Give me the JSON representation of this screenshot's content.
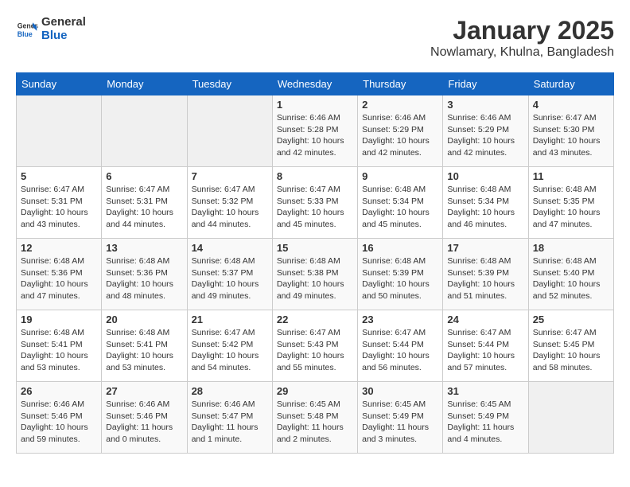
{
  "header": {
    "logo_general": "General",
    "logo_blue": "Blue",
    "title": "January 2025",
    "subtitle": "Nowlamary, Khulna, Bangladesh"
  },
  "days_of_week": [
    "Sunday",
    "Monday",
    "Tuesday",
    "Wednesday",
    "Thursday",
    "Friday",
    "Saturday"
  ],
  "weeks": [
    [
      {
        "day": "",
        "info": ""
      },
      {
        "day": "",
        "info": ""
      },
      {
        "day": "",
        "info": ""
      },
      {
        "day": "1",
        "info": "Sunrise: 6:46 AM\nSunset: 5:28 PM\nDaylight: 10 hours\nand 42 minutes."
      },
      {
        "day": "2",
        "info": "Sunrise: 6:46 AM\nSunset: 5:29 PM\nDaylight: 10 hours\nand 42 minutes."
      },
      {
        "day": "3",
        "info": "Sunrise: 6:46 AM\nSunset: 5:29 PM\nDaylight: 10 hours\nand 42 minutes."
      },
      {
        "day": "4",
        "info": "Sunrise: 6:47 AM\nSunset: 5:30 PM\nDaylight: 10 hours\nand 43 minutes."
      }
    ],
    [
      {
        "day": "5",
        "info": "Sunrise: 6:47 AM\nSunset: 5:31 PM\nDaylight: 10 hours\nand 43 minutes."
      },
      {
        "day": "6",
        "info": "Sunrise: 6:47 AM\nSunset: 5:31 PM\nDaylight: 10 hours\nand 44 minutes."
      },
      {
        "day": "7",
        "info": "Sunrise: 6:47 AM\nSunset: 5:32 PM\nDaylight: 10 hours\nand 44 minutes."
      },
      {
        "day": "8",
        "info": "Sunrise: 6:47 AM\nSunset: 5:33 PM\nDaylight: 10 hours\nand 45 minutes."
      },
      {
        "day": "9",
        "info": "Sunrise: 6:48 AM\nSunset: 5:34 PM\nDaylight: 10 hours\nand 45 minutes."
      },
      {
        "day": "10",
        "info": "Sunrise: 6:48 AM\nSunset: 5:34 PM\nDaylight: 10 hours\nand 46 minutes."
      },
      {
        "day": "11",
        "info": "Sunrise: 6:48 AM\nSunset: 5:35 PM\nDaylight: 10 hours\nand 47 minutes."
      }
    ],
    [
      {
        "day": "12",
        "info": "Sunrise: 6:48 AM\nSunset: 5:36 PM\nDaylight: 10 hours\nand 47 minutes."
      },
      {
        "day": "13",
        "info": "Sunrise: 6:48 AM\nSunset: 5:36 PM\nDaylight: 10 hours\nand 48 minutes."
      },
      {
        "day": "14",
        "info": "Sunrise: 6:48 AM\nSunset: 5:37 PM\nDaylight: 10 hours\nand 49 minutes."
      },
      {
        "day": "15",
        "info": "Sunrise: 6:48 AM\nSunset: 5:38 PM\nDaylight: 10 hours\nand 49 minutes."
      },
      {
        "day": "16",
        "info": "Sunrise: 6:48 AM\nSunset: 5:39 PM\nDaylight: 10 hours\nand 50 minutes."
      },
      {
        "day": "17",
        "info": "Sunrise: 6:48 AM\nSunset: 5:39 PM\nDaylight: 10 hours\nand 51 minutes."
      },
      {
        "day": "18",
        "info": "Sunrise: 6:48 AM\nSunset: 5:40 PM\nDaylight: 10 hours\nand 52 minutes."
      }
    ],
    [
      {
        "day": "19",
        "info": "Sunrise: 6:48 AM\nSunset: 5:41 PM\nDaylight: 10 hours\nand 53 minutes."
      },
      {
        "day": "20",
        "info": "Sunrise: 6:48 AM\nSunset: 5:41 PM\nDaylight: 10 hours\nand 53 minutes."
      },
      {
        "day": "21",
        "info": "Sunrise: 6:47 AM\nSunset: 5:42 PM\nDaylight: 10 hours\nand 54 minutes."
      },
      {
        "day": "22",
        "info": "Sunrise: 6:47 AM\nSunset: 5:43 PM\nDaylight: 10 hours\nand 55 minutes."
      },
      {
        "day": "23",
        "info": "Sunrise: 6:47 AM\nSunset: 5:44 PM\nDaylight: 10 hours\nand 56 minutes."
      },
      {
        "day": "24",
        "info": "Sunrise: 6:47 AM\nSunset: 5:44 PM\nDaylight: 10 hours\nand 57 minutes."
      },
      {
        "day": "25",
        "info": "Sunrise: 6:47 AM\nSunset: 5:45 PM\nDaylight: 10 hours\nand 58 minutes."
      }
    ],
    [
      {
        "day": "26",
        "info": "Sunrise: 6:46 AM\nSunset: 5:46 PM\nDaylight: 10 hours\nand 59 minutes."
      },
      {
        "day": "27",
        "info": "Sunrise: 6:46 AM\nSunset: 5:46 PM\nDaylight: 11 hours\nand 0 minutes."
      },
      {
        "day": "28",
        "info": "Sunrise: 6:46 AM\nSunset: 5:47 PM\nDaylight: 11 hours\nand 1 minute."
      },
      {
        "day": "29",
        "info": "Sunrise: 6:45 AM\nSunset: 5:48 PM\nDaylight: 11 hours\nand 2 minutes."
      },
      {
        "day": "30",
        "info": "Sunrise: 6:45 AM\nSunset: 5:49 PM\nDaylight: 11 hours\nand 3 minutes."
      },
      {
        "day": "31",
        "info": "Sunrise: 6:45 AM\nSunset: 5:49 PM\nDaylight: 11 hours\nand 4 minutes."
      },
      {
        "day": "",
        "info": ""
      }
    ]
  ]
}
